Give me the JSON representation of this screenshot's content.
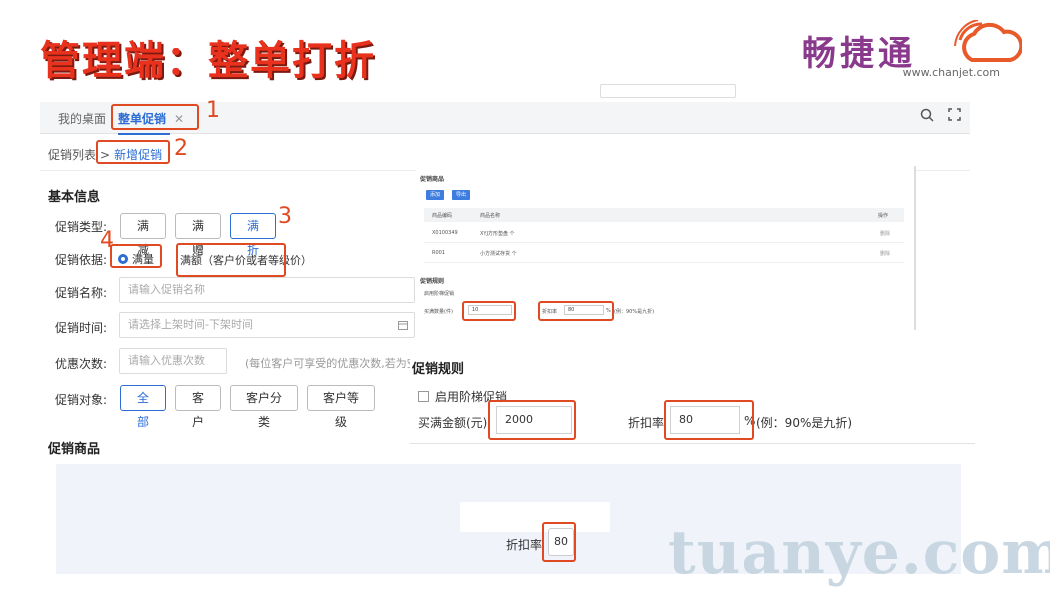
{
  "slide": {
    "title": "管理端：整单打折"
  },
  "logo": {
    "name": "畅捷通",
    "url": "www.chanjet.com"
  },
  "tabs": {
    "home": "我的桌面",
    "active": "整单促销",
    "close": "✕"
  },
  "toolbar": {
    "search_icon": "search-icon",
    "fullscreen_icon": "fullscreen-icon"
  },
  "breadcrumb": {
    "parent": "促销列表",
    "sep": ">",
    "current": "新增促销"
  },
  "annotations": {
    "n1": "1",
    "n2": "2",
    "n3": "3",
    "n4": "4"
  },
  "basic": {
    "heading": "基本信息",
    "type_label": "促销类型:",
    "types": [
      "满减",
      "满赠",
      "满折"
    ],
    "basis_label": "促销依据:",
    "basis_qty": "满量",
    "basis_amount": "满额（客户价或者等级价）",
    "name_label": "促销名称:",
    "name_placeholder": "请输入促销名称",
    "time_label": "促销时间:",
    "time_placeholder": "请选择上架时间-下架时间",
    "times_label": "优惠次数:",
    "times_placeholder": "请输入优惠次数",
    "times_hint": "(每位客户可享受的优惠次数,若为空，则不",
    "target_label": "促销对象:",
    "targets": [
      "全部",
      "客户",
      "客户分类",
      "客户等级"
    ]
  },
  "products_heading": "促销商品",
  "mini": {
    "title": "促销商品",
    "btn_add": "添加",
    "btn_import": "导出",
    "headers": [
      "商品编码",
      "商品名称",
      "操作"
    ],
    "rows": [
      {
        "code": "X0100349",
        "name": "XYJ方形垫盘 个",
        "op": "删除"
      },
      {
        "code": "R001",
        "name": "小方测试存货 个",
        "op": "删除"
      }
    ],
    "rules_title": "促销规则",
    "ladder": "启用阶梯促销",
    "qty_label": "买满数量(件)",
    "qty_value": "10",
    "rate_label": "折扣率",
    "rate_value": "80",
    "pct": "%",
    "hint": "(例：90%是九折)"
  },
  "rules": {
    "title": "促销规则",
    "ladder": "启用阶梯促销",
    "amount_label": "买满金额(元)",
    "amount_value": "2000",
    "rate_label": "折扣率",
    "rate_value": "80",
    "pct": "%",
    "hint": "(例：90%是九折)"
  },
  "bottom": {
    "rate_label": "折扣率",
    "rate_value": "80"
  },
  "watermark": "tuanye.com",
  "colors": {
    "accent": "#2d6ed4",
    "title_red": "#e8321e",
    "annotation": "#e04a22"
  }
}
